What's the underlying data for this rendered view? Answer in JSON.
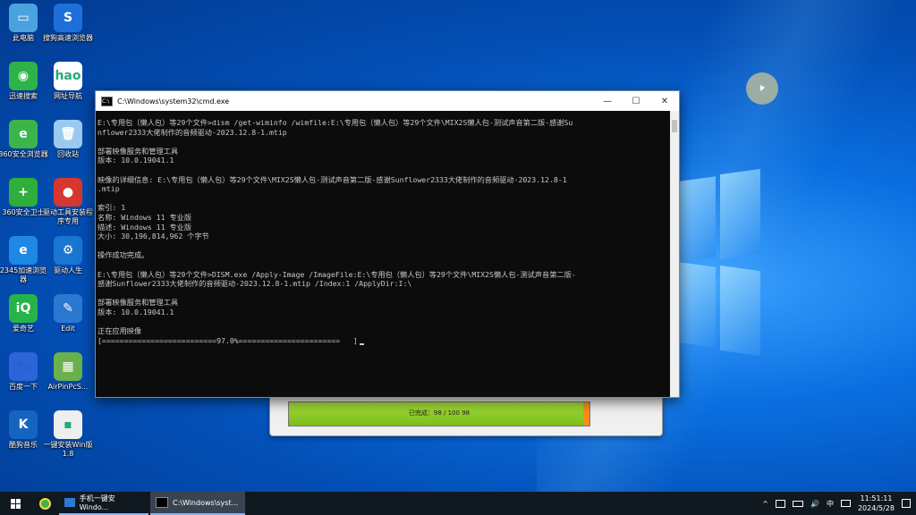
{
  "desktop_icons": [
    {
      "label": "此电脑",
      "glyph": "▭",
      "color": "#4aa3df"
    },
    {
      "label": "搜狗高速浏览器",
      "glyph": "S",
      "color": "#1e6fd9"
    },
    {
      "label": "迅速搜索",
      "glyph": "◉",
      "color": "#2db34a"
    },
    {
      "label": "网址导航",
      "glyph": "hao",
      "color": "#ffffff"
    },
    {
      "label": "360安全浏览器",
      "glyph": "e",
      "color": "#3bb54a"
    },
    {
      "label": "回收站",
      "glyph": "🗑",
      "color": "#9cc9f0"
    },
    {
      "label": "360安全卫士",
      "glyph": "+",
      "color": "#2fae3c"
    },
    {
      "label": "驱动工具安装程序专用",
      "glyph": "●",
      "color": "#d6382f"
    },
    {
      "label": "2345加速浏览器",
      "glyph": "e",
      "color": "#1e88e5"
    },
    {
      "label": "驱动人生",
      "glyph": "⚙",
      "color": "#1976d2"
    },
    {
      "label": "爱奇艺",
      "glyph": "iQ",
      "color": "#26b44a"
    },
    {
      "label": "Edit",
      "glyph": "✎",
      "color": "#2a78d0"
    },
    {
      "label": "百度一下",
      "glyph": "🐾",
      "color": "#2d64d8"
    },
    {
      "label": "AirPinPcS...",
      "glyph": "▦",
      "color": "#6ab04c"
    },
    {
      "label": "酷狗音乐",
      "glyph": "K",
      "color": "#1565c0"
    },
    {
      "label": "一键安装Win版1.8",
      "glyph": "▪",
      "color": "#eeeeee"
    }
  ],
  "cmd": {
    "title": "C:\\Windows\\system32\\cmd.exe",
    "icon_label": "C:\\",
    "controls": {
      "minimize": "—",
      "maximize": "☐",
      "close": "✕"
    },
    "lines": [
      "E:\\专用包（懒人包）等29个文件>dism /get-wiminfo /wimfile:E:\\专用包（懒人包）等29个文件\\MIX2S懒人包-测试声音第二版-感谢Su",
      "nflower2333大佬制作的音频驱动-2023.12.8-1.mtip",
      "",
      "部署映像服务和管理工具",
      "版本: 10.0.19041.1",
      "",
      "映像的详细信息: E:\\专用包（懒人包）等29个文件\\MIX2S懒人包-测试声音第二版-感谢Sunflower2333大佬制作的音频驱动-2023.12.8-1",
      ".mtip",
      "",
      "索引: 1",
      "名称: Windows 11 专业版",
      "描述: Windows 11 专业版",
      "大小: 30,196,814,962 个字节",
      "",
      "操作成功完成。",
      "",
      "E:\\专用包（懒人包）等29个文件>DISM.exe /Apply-Image /ImageFile:E:\\专用包（懒人包）等29个文件\\MIX2S懒人包-测试声音第二版-",
      "感谢Sunflower2333大佬制作的音频驱动-2023.12.8-1.mtip /Index:1 /ApplyDir:I:\\",
      "",
      "部署映像服务和管理工具",
      "版本: 10.0.19041.1",
      "",
      "正在应用映像",
      "[==========================97.0%=======================   ]"
    ]
  },
  "progress": {
    "text": "已完成：98 / 100  98",
    "percent": 98
  },
  "taskbar": {
    "tasks": [
      {
        "label": "手机一键安Windo...",
        "active": false
      },
      {
        "label": "C:\\Windows\\syst...",
        "active": true
      }
    ],
    "tray": {
      "chevron": "^",
      "ime": "中",
      "time": "11:51:11",
      "date": "2024/5/28"
    }
  }
}
